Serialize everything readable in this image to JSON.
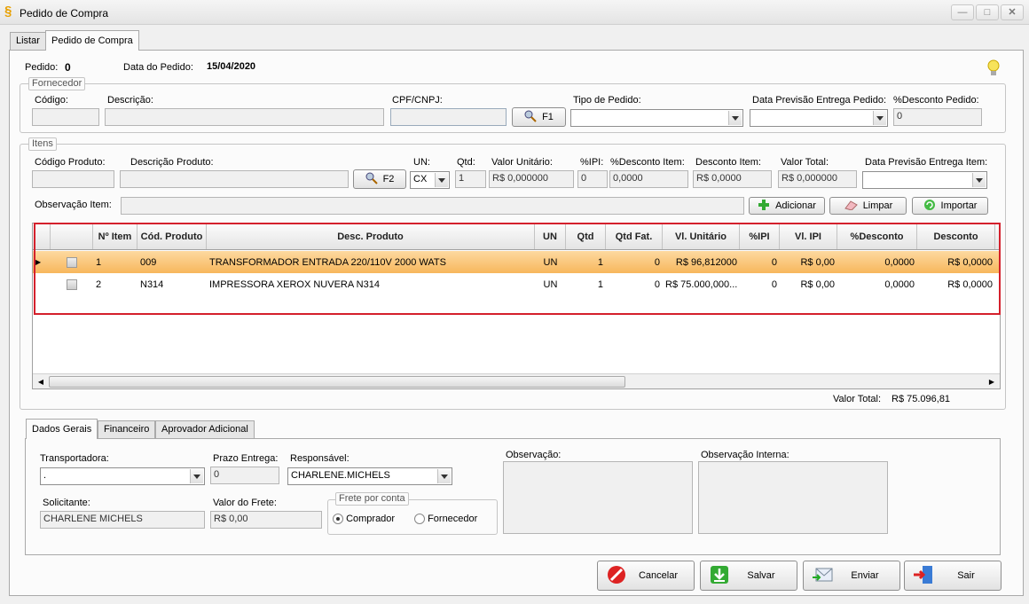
{
  "window": {
    "title": "Pedido de Compra"
  },
  "tabs": [
    {
      "label": "Listar"
    },
    {
      "label": "Pedido de Compra"
    }
  ],
  "header": {
    "pedido_label": "Pedido:",
    "pedido_value": "0",
    "data_label": "Data do Pedido:",
    "data_value": "15/04/2020"
  },
  "fornecedor": {
    "group_title": "Fornecedor",
    "codigo_label": "Código:",
    "codigo_value": "",
    "descricao_label": "Descrição:",
    "descricao_value": "",
    "cpf_label": "CPF/CNPJ:",
    "cpf_value": "",
    "f1_label": "F1",
    "tipo_label": "Tipo de Pedido:",
    "tipo_value": "",
    "previsao_label": "Data Previsão Entrega Pedido:",
    "previsao_value": "",
    "desconto_label": "%Desconto Pedido:",
    "desconto_value": "0"
  },
  "itens": {
    "group_title": "Itens",
    "codprod_label": "Código Produto:",
    "codprod_value": "",
    "descprod_label": "Descrição Produto:",
    "descprod_value": "",
    "f2_label": "F2",
    "un_label": "UN:",
    "un_value": "CX",
    "qtd_label": "Qtd:",
    "qtd_value": "1",
    "valunit_label": "Valor Unitário:",
    "valunit_value": "R$ 0,000000",
    "ipi_label": "%IPI:",
    "ipi_value": "0",
    "descitem_label": "%Desconto Item:",
    "descitem_value": "0,0000",
    "descontoitem_label": "Desconto Item:",
    "descontoitem_value": "R$ 0,0000",
    "valtotal_label": "Valor Total:",
    "valtotal_value": "R$ 0,000000",
    "previsaoitem_label": "Data Previsão Entrega Item:",
    "previsaoitem_value": "",
    "obs_label": "Observação Item:",
    "obs_value": "",
    "adicionar_label": "Adicionar",
    "limpar_label": "Limpar",
    "importar_label": "Importar"
  },
  "grid": {
    "columns": [
      "Nº Item",
      "Cód. Produto",
      "Desc. Produto",
      "UN",
      "Qtd",
      "Qtd Fat.",
      "Vl. Unitário",
      "%IPI",
      "Vl. IPI",
      "%Desconto",
      "Desconto"
    ],
    "rows": [
      {
        "item": "1",
        "cod": "009",
        "desc": "TRANSFORMADOR ENTRADA 220/110V 2000 WATS",
        "un": "UN",
        "qtd": "1",
        "qtdfat": "0",
        "vlunit": "R$ 96,812000",
        "ipi": "0",
        "vlipi": "R$ 0,00",
        "pdesc": "0,0000",
        "desconto": "R$ 0,0000"
      },
      {
        "item": "2",
        "cod": "N314",
        "desc": "IMPRESSORA XEROX NUVERA N314",
        "un": "UN",
        "qtd": "1",
        "qtdfat": "0",
        "vlunit": "R$ 75.000,000...",
        "ipi": "0",
        "vlipi": "R$ 0,00",
        "pdesc": "0,0000",
        "desconto": "R$ 0,0000"
      }
    ]
  },
  "total": {
    "label": "Valor Total:",
    "value": "R$ 75.096,81"
  },
  "bottom_tabs": [
    {
      "label": "Dados Gerais"
    },
    {
      "label": "Financeiro"
    },
    {
      "label": "Aprovador Adicional"
    }
  ],
  "dados": {
    "transportadora_label": "Transportadora:",
    "transportadora_value": ".",
    "prazo_label": "Prazo Entrega:",
    "prazo_value": "0",
    "responsavel_label": "Responsável:",
    "responsavel_value": "CHARLENE.MICHELS",
    "solicitante_label": "Solicitante:",
    "solicitante_value": "CHARLENE MICHELS",
    "frete_label": "Valor do Frete:",
    "frete_value": "R$ 0,00",
    "frete_conta_title": "Frete por conta",
    "comprador_label": "Comprador",
    "fornecedor_label": "Fornecedor",
    "observacao_label": "Observação:",
    "obs_interna_label": "Observação Interna:"
  },
  "actions": {
    "cancelar": "Cancelar",
    "salvar": "Salvar",
    "enviar": "Enviar",
    "sair": "Sair"
  }
}
